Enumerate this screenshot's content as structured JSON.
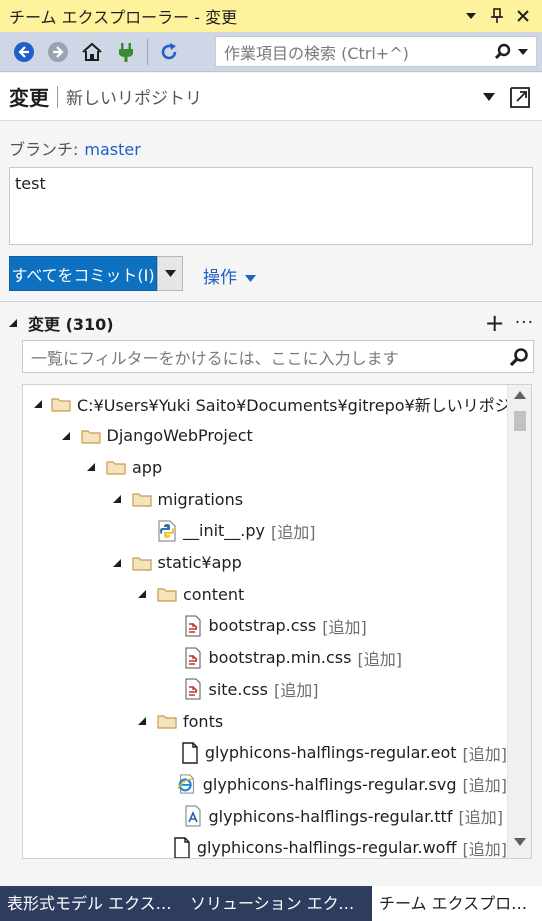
{
  "titlebar": {
    "title": "チーム エクスプローラー - 変更"
  },
  "toolbar": {
    "search_placeholder": "作業項目の検索 (Ctrl+^)"
  },
  "header": {
    "title": "変更",
    "subtitle": "新しいリポジトリ"
  },
  "branch": {
    "label": "ブランチ:",
    "name": "master"
  },
  "commit_message": "test",
  "commit_button": "すべてをコミット(I)",
  "actions_label": "操作",
  "changes": {
    "title": "変更 (310)",
    "filter_placeholder": "一覧にフィルターをかけるには、ここに入力します"
  },
  "tree": [
    {
      "label": "C:¥Users¥Yuki Saito¥Documents¥gitrepo¥新しいリポジトリ",
      "tag": "",
      "type": "folder",
      "level": 0,
      "expanded": true
    },
    {
      "label": "DjangoWebProject",
      "tag": "",
      "type": "folder",
      "level": 1,
      "expanded": true
    },
    {
      "label": "app",
      "tag": "",
      "type": "folder",
      "level": 2,
      "expanded": true
    },
    {
      "label": "migrations",
      "tag": "",
      "type": "folder",
      "level": 3,
      "expanded": true
    },
    {
      "label": "__init__.py",
      "tag": "[追加]",
      "type": "python",
      "level": 4
    },
    {
      "label": "static¥app",
      "tag": "",
      "type": "folder",
      "level": 3,
      "expanded": true
    },
    {
      "label": "content",
      "tag": "",
      "type": "folder",
      "level": 4,
      "expanded": true
    },
    {
      "label": "bootstrap.css",
      "tag": "[追加]",
      "type": "css",
      "level": 5
    },
    {
      "label": "bootstrap.min.css",
      "tag": "[追加]",
      "type": "css",
      "level": 5
    },
    {
      "label": "site.css",
      "tag": "[追加]",
      "type": "css",
      "level": 5
    },
    {
      "label": "fonts",
      "tag": "",
      "type": "folder",
      "level": 4,
      "expanded": true
    },
    {
      "label": "glyphicons-halflings-regular.eot",
      "tag": "[追加]",
      "type": "file",
      "level": 5
    },
    {
      "label": "glyphicons-halflings-regular.svg",
      "tag": "[追加]",
      "type": "ie",
      "level": 5
    },
    {
      "label": "glyphicons-halflings-regular.ttf",
      "tag": "[追加]",
      "type": "font",
      "level": 5
    },
    {
      "label": "glyphicons-halflings-regular.woff",
      "tag": "[追加]",
      "type": "file",
      "level": 5
    }
  ],
  "tabs": [
    {
      "label": "表形式モデル エクスプローラー",
      "active": false
    },
    {
      "label": "ソリューション エクスプローラー",
      "active": false
    },
    {
      "label": "チーム エクスプローラー",
      "active": true
    }
  ],
  "colors": {
    "titlebar_bg": "#fff29d",
    "toolbar_bg": "#cfd6e5",
    "accent": "#0e70c0",
    "link": "#1f5fc7",
    "tabs_bg": "#2e3d5e",
    "folder": "#dcb67a"
  },
  "icons": {
    "back": "back-circle-icon",
    "forward": "forward-circle-icon",
    "home": "home-icon",
    "connect": "plug-icon",
    "refresh": "refresh-icon",
    "search": "search-icon",
    "pin": "pin-icon",
    "close": "close-icon",
    "folder": "folder-icon",
    "python_file": "python-file-icon",
    "css_file": "css-file-icon",
    "generic_file": "file-icon",
    "ie_file": "ie-file-icon",
    "font_file": "font-file-icon"
  }
}
